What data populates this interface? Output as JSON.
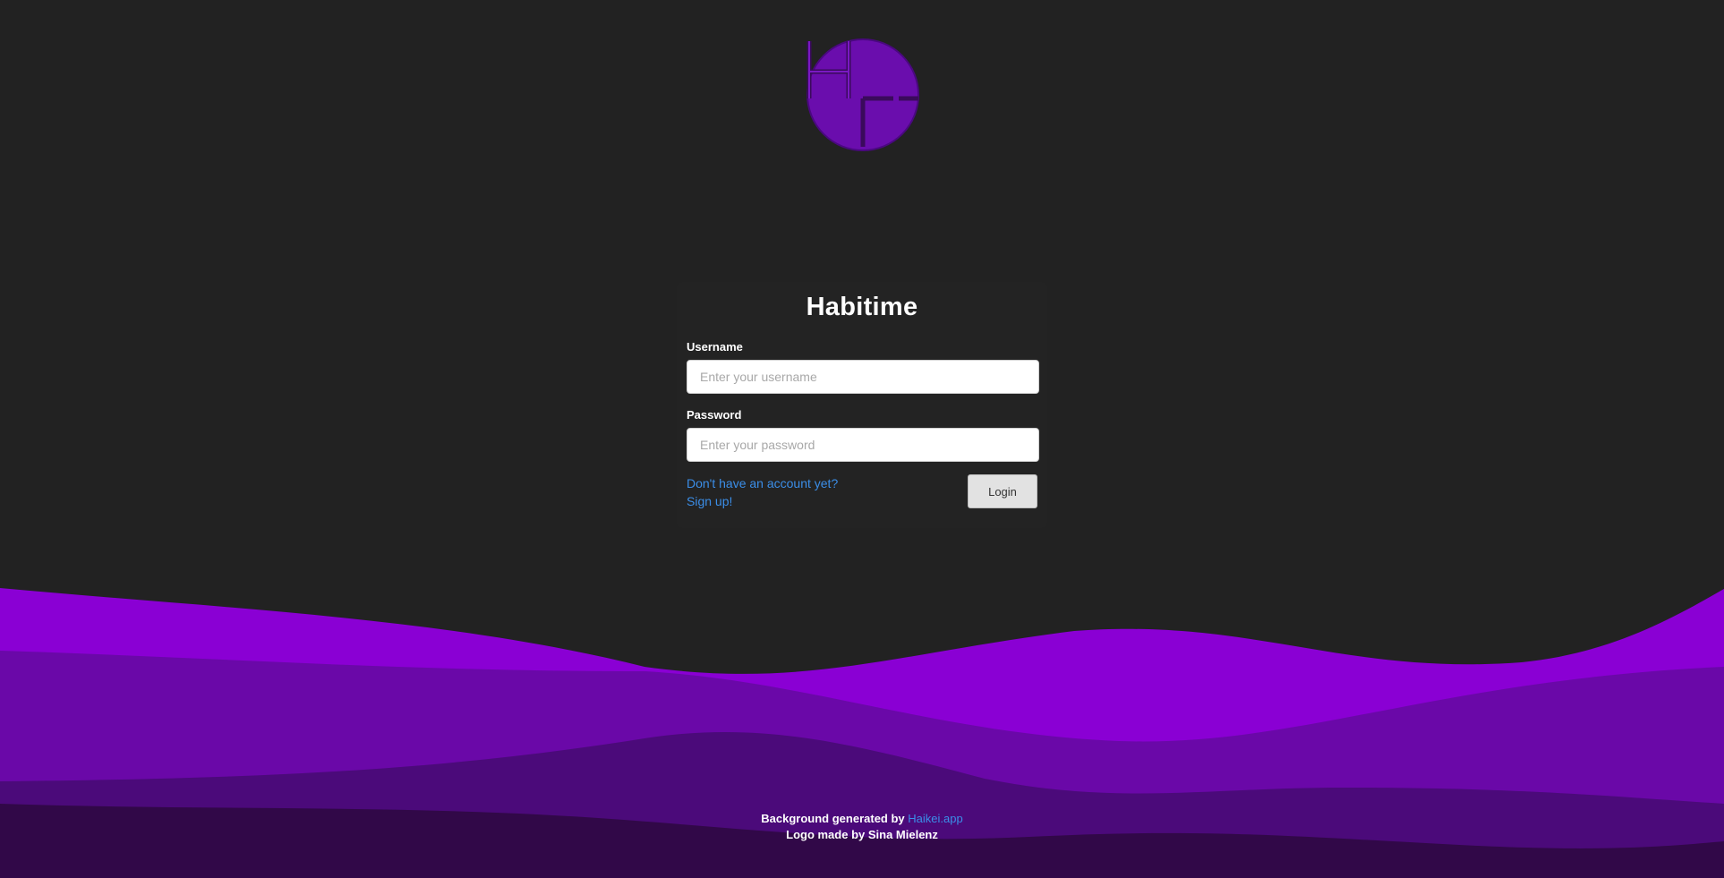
{
  "app": {
    "title": "Habitime"
  },
  "logo": {
    "icon": "habitime-logo-icon",
    "color": "#6a0dad"
  },
  "login_form": {
    "username_label": "Username",
    "username_placeholder": "Enter your username",
    "username_value": "",
    "password_label": "Password",
    "password_placeholder": "Enter your password",
    "password_value": "",
    "signup_prompt": "Don't have an account yet?",
    "signup_link": "Sign up!",
    "login_label": "Login"
  },
  "footer": {
    "background_prefix": "Background generated by",
    "background_link": "Haikei.app",
    "logo_credit": "Logo made by Sina Mielenz"
  },
  "colors": {
    "background": "#222222",
    "wave_1": "#8a00d4",
    "wave_2": "#6a08a8",
    "wave_3": "#4b0a7a",
    "wave_4": "#310848",
    "link": "#3b8ee8"
  }
}
